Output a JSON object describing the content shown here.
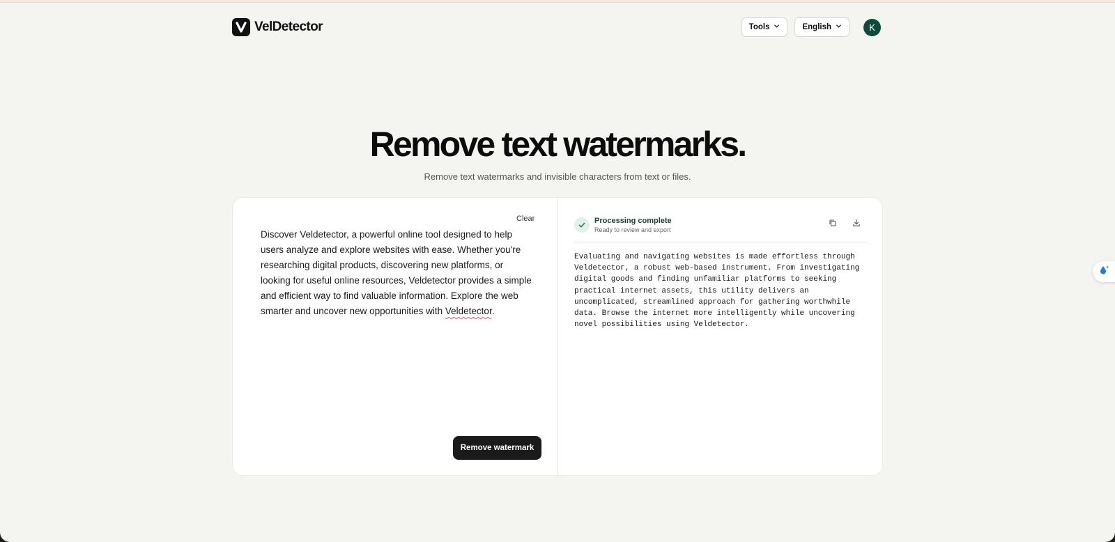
{
  "brand": {
    "name": "VelDetector"
  },
  "nav": {
    "tools_label": "Tools",
    "language_label": "English",
    "avatar_initial": "K"
  },
  "hero": {
    "title": "Remove text watermarks.",
    "subtitle": "Remove text watermarks and invisible characters from text or files."
  },
  "input": {
    "clear_label": "Clear",
    "text_main": "Discover Veldetector, a powerful online tool designed to help users analyze and explore websites with ease. Whether you're researching digital products, discovering new platforms, or looking for useful online resources, Veldetector provides a simple and efficient way to find valuable information. Explore the web smarter and uncover new opportunities with ",
    "text_last_word": "Veldetector",
    "text_end": ".",
    "remove_button_label": "Remove watermark"
  },
  "output": {
    "status_title": "Processing complete",
    "status_subtitle": "Ready to review and export",
    "text": "Evaluating and navigating websites is made effortless through\nVeldetector, a robust web-based instrument. From investigating\ndigital goods and finding unfamiliar platforms to seeking\npractical internet assets, this utility delivers an\nuncomplicated, streamlined approach for gathering worthwhile\ndata. Browse the internet more intelligently while uncovering\nnovel possibilities using Veldetector."
  },
  "icons": {
    "logo": "v-logo-icon",
    "tools_chevron": "chevron-down-icon",
    "language_chevron": "chevron-down-icon",
    "status": "check-icon",
    "copy": "copy-icon",
    "download": "download-icon",
    "side_widget": "droplet-sparkle-icon"
  },
  "colors": {
    "accent_dark": "#1a1a1a",
    "avatar_bg": "#0e4a3c",
    "success_bg": "#e2f2e6",
    "success_fg": "#2f7a4a"
  }
}
